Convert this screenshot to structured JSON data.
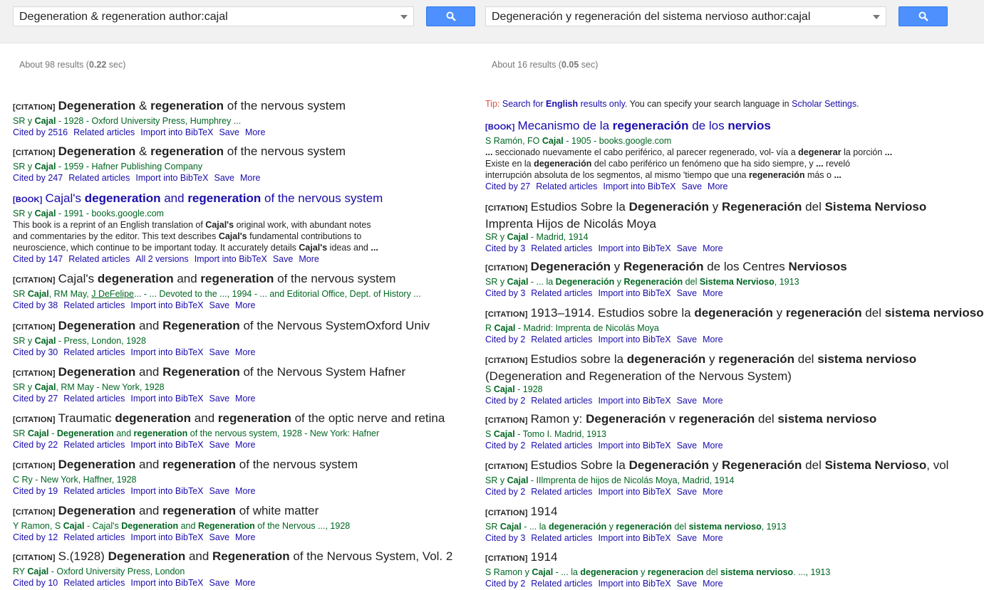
{
  "left": {
    "query": "Degeneration & regeneration  author:cajal",
    "stats": {
      "prefix": "About 98 results (",
      "time": "0.22",
      "suffix": " sec)"
    },
    "results": [
      {
        "tag": "[CITATION]",
        "title": "<b>Degeneration</b> &amp; <b>regeneration</b> of the nervous system",
        "meta": "SR y <b>Cajal</b> - 1928 - Oxford University Press, Humphrey ...",
        "links": [
          "Cited by 2516",
          "Related articles",
          "Import into BibTeX",
          "Save",
          "More"
        ]
      },
      {
        "tag": "[CITATION]",
        "title": "<b>Degeneration</b> &amp; <b>regeneration</b> of the nervous system",
        "meta": "SR y <b>Cajal</b> - 1959 - Hafner Publishing Company",
        "links": [
          "Cited by 247",
          "Related articles",
          "Import into BibTeX",
          "Save",
          "More"
        ]
      },
      {
        "tag": "[BOOK]",
        "link": true,
        "title": "Cajal's <b>degeneration</b> and <b>regeneration</b> of the nervous system",
        "meta": "SR y <b>Cajal</b> - 1991 - books.google.com",
        "snippet": "This book is a reprint of an English translation of <b>Cajal's</b> original work, with abundant notes<br>and commentaries by the editor. This text describes <b>Cajal's</b> fundamental contributions to<br>neuroscience, which continue to be important today. It accurately details <b>Cajal's</b> ideas and <b>...</b>",
        "links": [
          "Cited by 147",
          "Related articles",
          "All 2 versions",
          "Import into BibTeX",
          "Save",
          "More"
        ]
      },
      {
        "tag": "[CITATION]",
        "title": "Cajal's <b>degeneration</b> and <b>regeneration</b> of the nervous system",
        "meta": "SR <b>Cajal</b>, RM May, <u>J DeFelipe</u>... - ... Devoted to the ..., 1994 - ... and Editorial Office, Dept. of History ...",
        "links": [
          "Cited by 38",
          "Related articles",
          "Import into BibTeX",
          "Save",
          "More"
        ]
      },
      {
        "tag": "[CITATION]",
        "title": "<b>Degeneration</b> and <b>Regeneration</b> of the Nervous SystemOxford Univ",
        "meta": "SR y <b>Cajal</b> - Press, London, 1928",
        "links": [
          "Cited by 30",
          "Related articles",
          "Import into BibTeX",
          "Save",
          "More"
        ]
      },
      {
        "tag": "[CITATION]",
        "title": "<b>Degeneration</b> and <b>Regeneration</b> of the Nervous System Hafner",
        "meta": "SR y <b>Cajal</b>, RM May - New York, 1928",
        "links": [
          "Cited by 27",
          "Related articles",
          "Import into BibTeX",
          "Save",
          "More"
        ]
      },
      {
        "tag": "[CITATION]",
        "title": "Traumatic <b>degeneration</b> and <b>regeneration</b> of the optic nerve and retina",
        "meta": "SR <b>Cajal</b> - <b>Degeneration</b> and <b>regeneration</b> of the nervous system, 1928 - New York: Hafner",
        "links": [
          "Cited by 22",
          "Related articles",
          "Import into BibTeX",
          "Save",
          "More"
        ]
      },
      {
        "tag": "[CITATION]",
        "title": "<b>Degeneration</b> and <b>regeneration</b> of the nervous system",
        "meta": "C Ry - New York, Haffner, 1928",
        "links": [
          "Cited by 19",
          "Related articles",
          "Import into BibTeX",
          "Save",
          "More"
        ]
      },
      {
        "tag": "[CITATION]",
        "title": "<b>Degeneration</b> and <b>regeneration</b> of white matter",
        "meta": "Y Ramon, S <b>Cajal</b> - Cajal's <b>Degeneration</b> and <b>Regeneration</b> of the Nervous ..., 1928",
        "links": [
          "Cited by 12",
          "Related articles",
          "Import into BibTeX",
          "Save",
          "More"
        ]
      },
      {
        "tag": "[CITATION]",
        "title": "S.(1928) <b>Degeneration</b> and <b>Regeneration</b> of the Nervous System, Vol. 2",
        "meta": "RY <b>Cajal</b> - Oxford University Press, London",
        "links": [
          "Cited by 10",
          "Related articles",
          "Import into BibTeX",
          "Save",
          "More"
        ]
      }
    ]
  },
  "right": {
    "query": "Degeneración y regeneración del sistema nervioso  author:cajal",
    "stats": {
      "prefix": "About 16 results (",
      "time": "0.05",
      "suffix": " sec)"
    },
    "tip": {
      "label": "Tip:",
      "link1": "Search for <b>English</b> results only",
      "mid": ". You can specify your search language in ",
      "link2": "Scholar Settings",
      "end": "."
    },
    "results": [
      {
        "tag": "[BOOK]",
        "link": true,
        "title": "Mecanismo de la <b>regeneración</b> de los <b>nervios</b>",
        "meta": "S Ramón, FO <b>Cajal</b> - 1905 - books.google.com",
        "snippet": "<b>...</b> seccionado nuevamente el cabo periférico, al parecer regenerado, vol- vía a <b>degenerar</b> la porción <b>...</b><br>Existe en la <b>degeneración</b> del cabo periférico un fenómeno que ha sido siempre, y <b>...</b> reveló<br>interrupción absoluta de los segmentos, al mismo 'tiempo que una <b>regeneración</b> más o <b>...</b>",
        "links": [
          "Cited by 27",
          "Related articles",
          "Import into BibTeX",
          "Save",
          "More"
        ]
      },
      {
        "tag": "[CITATION]",
        "wrap": true,
        "title": "Estudios Sobre la <b>Degeneración</b> y <b>Regeneración</b> del <b>Sistema Nervioso</b> Imprenta Hijos de Nicolás Moya",
        "meta": "SR y <b>Cajal</b> - Madrid, 1914",
        "links": [
          "Cited by 3",
          "Related articles",
          "Import into BibTeX",
          "Save",
          "More"
        ]
      },
      {
        "tag": "[CITATION]",
        "title": "<b>Degeneración</b> y <b>Regeneración</b> de los Centres <b>Nerviosos</b>",
        "meta": "SR y <b>Cajal</b> - ... la <b>Degeneración</b> y <b>Regeneración</b> del <b>Sistema Nervioso</b>, 1913",
        "links": [
          "Cited by 3",
          "Related articles",
          "Import into BibTeX",
          "Save",
          "More"
        ]
      },
      {
        "tag": "[CITATION]",
        "title": "1913–1914. Estudios sobre la <b>degeneración</b> y <b>regeneración</b> del <b>sistema nervioso</b>",
        "meta": "R <b>Cajal</b> - Madrid: Imprenta de Nicolás Moya",
        "links": [
          "Cited by 2",
          "Related articles",
          "Import into BibTeX",
          "Save",
          "More"
        ]
      },
      {
        "tag": "[CITATION]",
        "wrap": true,
        "title": "Estudios sobre la <b>degeneración</b> y <b>regeneración</b> del <b>sistema nervioso</b> (Degeneration and Regeneration of the Nervous System)",
        "meta": "S <b>Cajal</b> - 1928",
        "links": [
          "Cited by 2",
          "Related articles",
          "Import into BibTeX",
          "Save",
          "More"
        ]
      },
      {
        "tag": "[CITATION]",
        "title": "Ramon y: <b>Degeneración</b> v <b>regeneración</b> del <b>sistema nervioso</b>",
        "meta": "S <b>Cajal</b> - Tomo I. Madrid, 1913",
        "links": [
          "Cited by 2",
          "Related articles",
          "Import into BibTeX",
          "Save",
          "More"
        ]
      },
      {
        "tag": "[CITATION]",
        "title": "Estudios Sobre la <b>Degeneración</b> y <b>Regeneración</b> del <b>Sistema Nervioso</b>, vol",
        "meta": "SR y <b>Cajal</b> - IIlmprenta de hijos de Nicolás Moya, Madrid, 1914",
        "links": [
          "Cited by 2",
          "Related articles",
          "Import into BibTeX",
          "Save",
          "More"
        ]
      },
      {
        "tag": "[CITATION]",
        "title": "1914",
        "meta": "SR <b>Cajal</b> - ... la <b>degeneración</b> y <b>regeneración</b> del <b>sistema nervioso</b>, 1913",
        "links": [
          "Cited by 3",
          "Related articles",
          "Import into BibTeX",
          "Save",
          "More"
        ]
      },
      {
        "tag": "[CITATION]",
        "title": "1914",
        "meta": "S Ramon y <b>Cajal</b> - ... la <b>degeneracion</b> y <b>regeneracion</b> del <b>sistema nervioso</b>. ..., 1913",
        "links": [
          "Cited by 2",
          "Related articles",
          "Import into BibTeX",
          "Save",
          "More"
        ]
      }
    ]
  },
  "colors": {
    "link": "#1a0dab",
    "meta": "#006621",
    "button": "#4d90fe",
    "tip": "#dd4b39"
  },
  "icons": {
    "search_button": "search-icon",
    "dropdown": "chevron-down-icon"
  }
}
